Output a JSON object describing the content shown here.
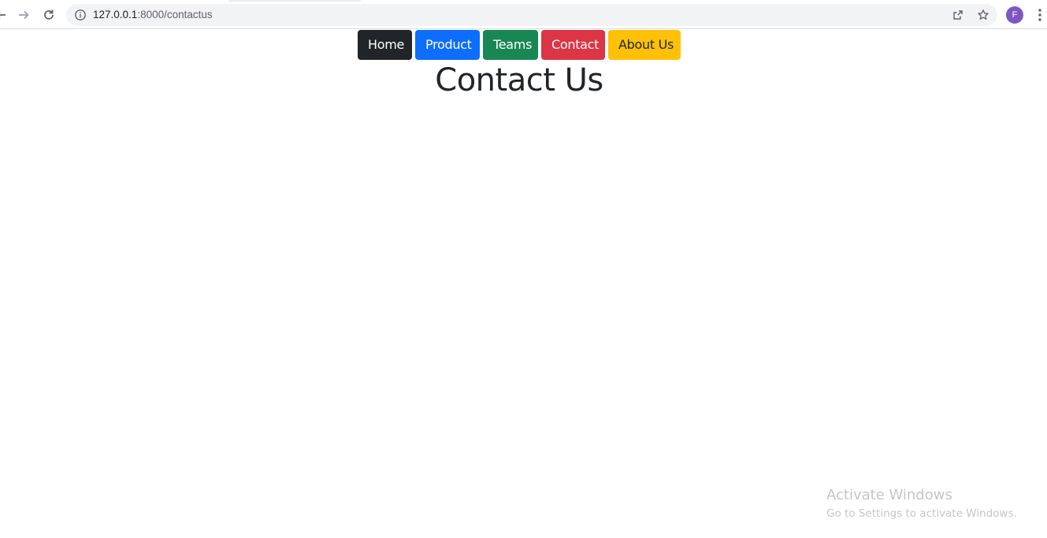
{
  "browser": {
    "url_host": "127.0.0.1",
    "url_path": ":8000/contactus",
    "profile_initial": "F",
    "icons": {
      "back": "back-arrow-icon",
      "forward": "forward-arrow-icon",
      "reload": "reload-icon",
      "site_info": "info-icon",
      "share": "share-icon",
      "bookmark": "star-icon",
      "menu": "kebab-menu-icon"
    }
  },
  "nav": {
    "buttons": [
      {
        "label": "Home",
        "bg": "#212529",
        "color": "#ffffff"
      },
      {
        "label": "Product",
        "bg": "#0d6efd",
        "color": "#ffffff"
      },
      {
        "label": "Teams",
        "bg": "#198754",
        "color": "#ffffff"
      },
      {
        "label": "Contact",
        "bg": "#dc3545",
        "color": "#ffffff"
      },
      {
        "label": "About Us",
        "bg": "#ffc107",
        "color": "#212529"
      }
    ]
  },
  "page": {
    "title": "Contact Us"
  },
  "watermark": {
    "title": "Activate Windows",
    "subtitle": "Go to Settings to activate Windows."
  },
  "colors": {
    "avatar": "#7e57c2",
    "omnibox_bg": "#f1f3f4",
    "heading": "#212529"
  }
}
